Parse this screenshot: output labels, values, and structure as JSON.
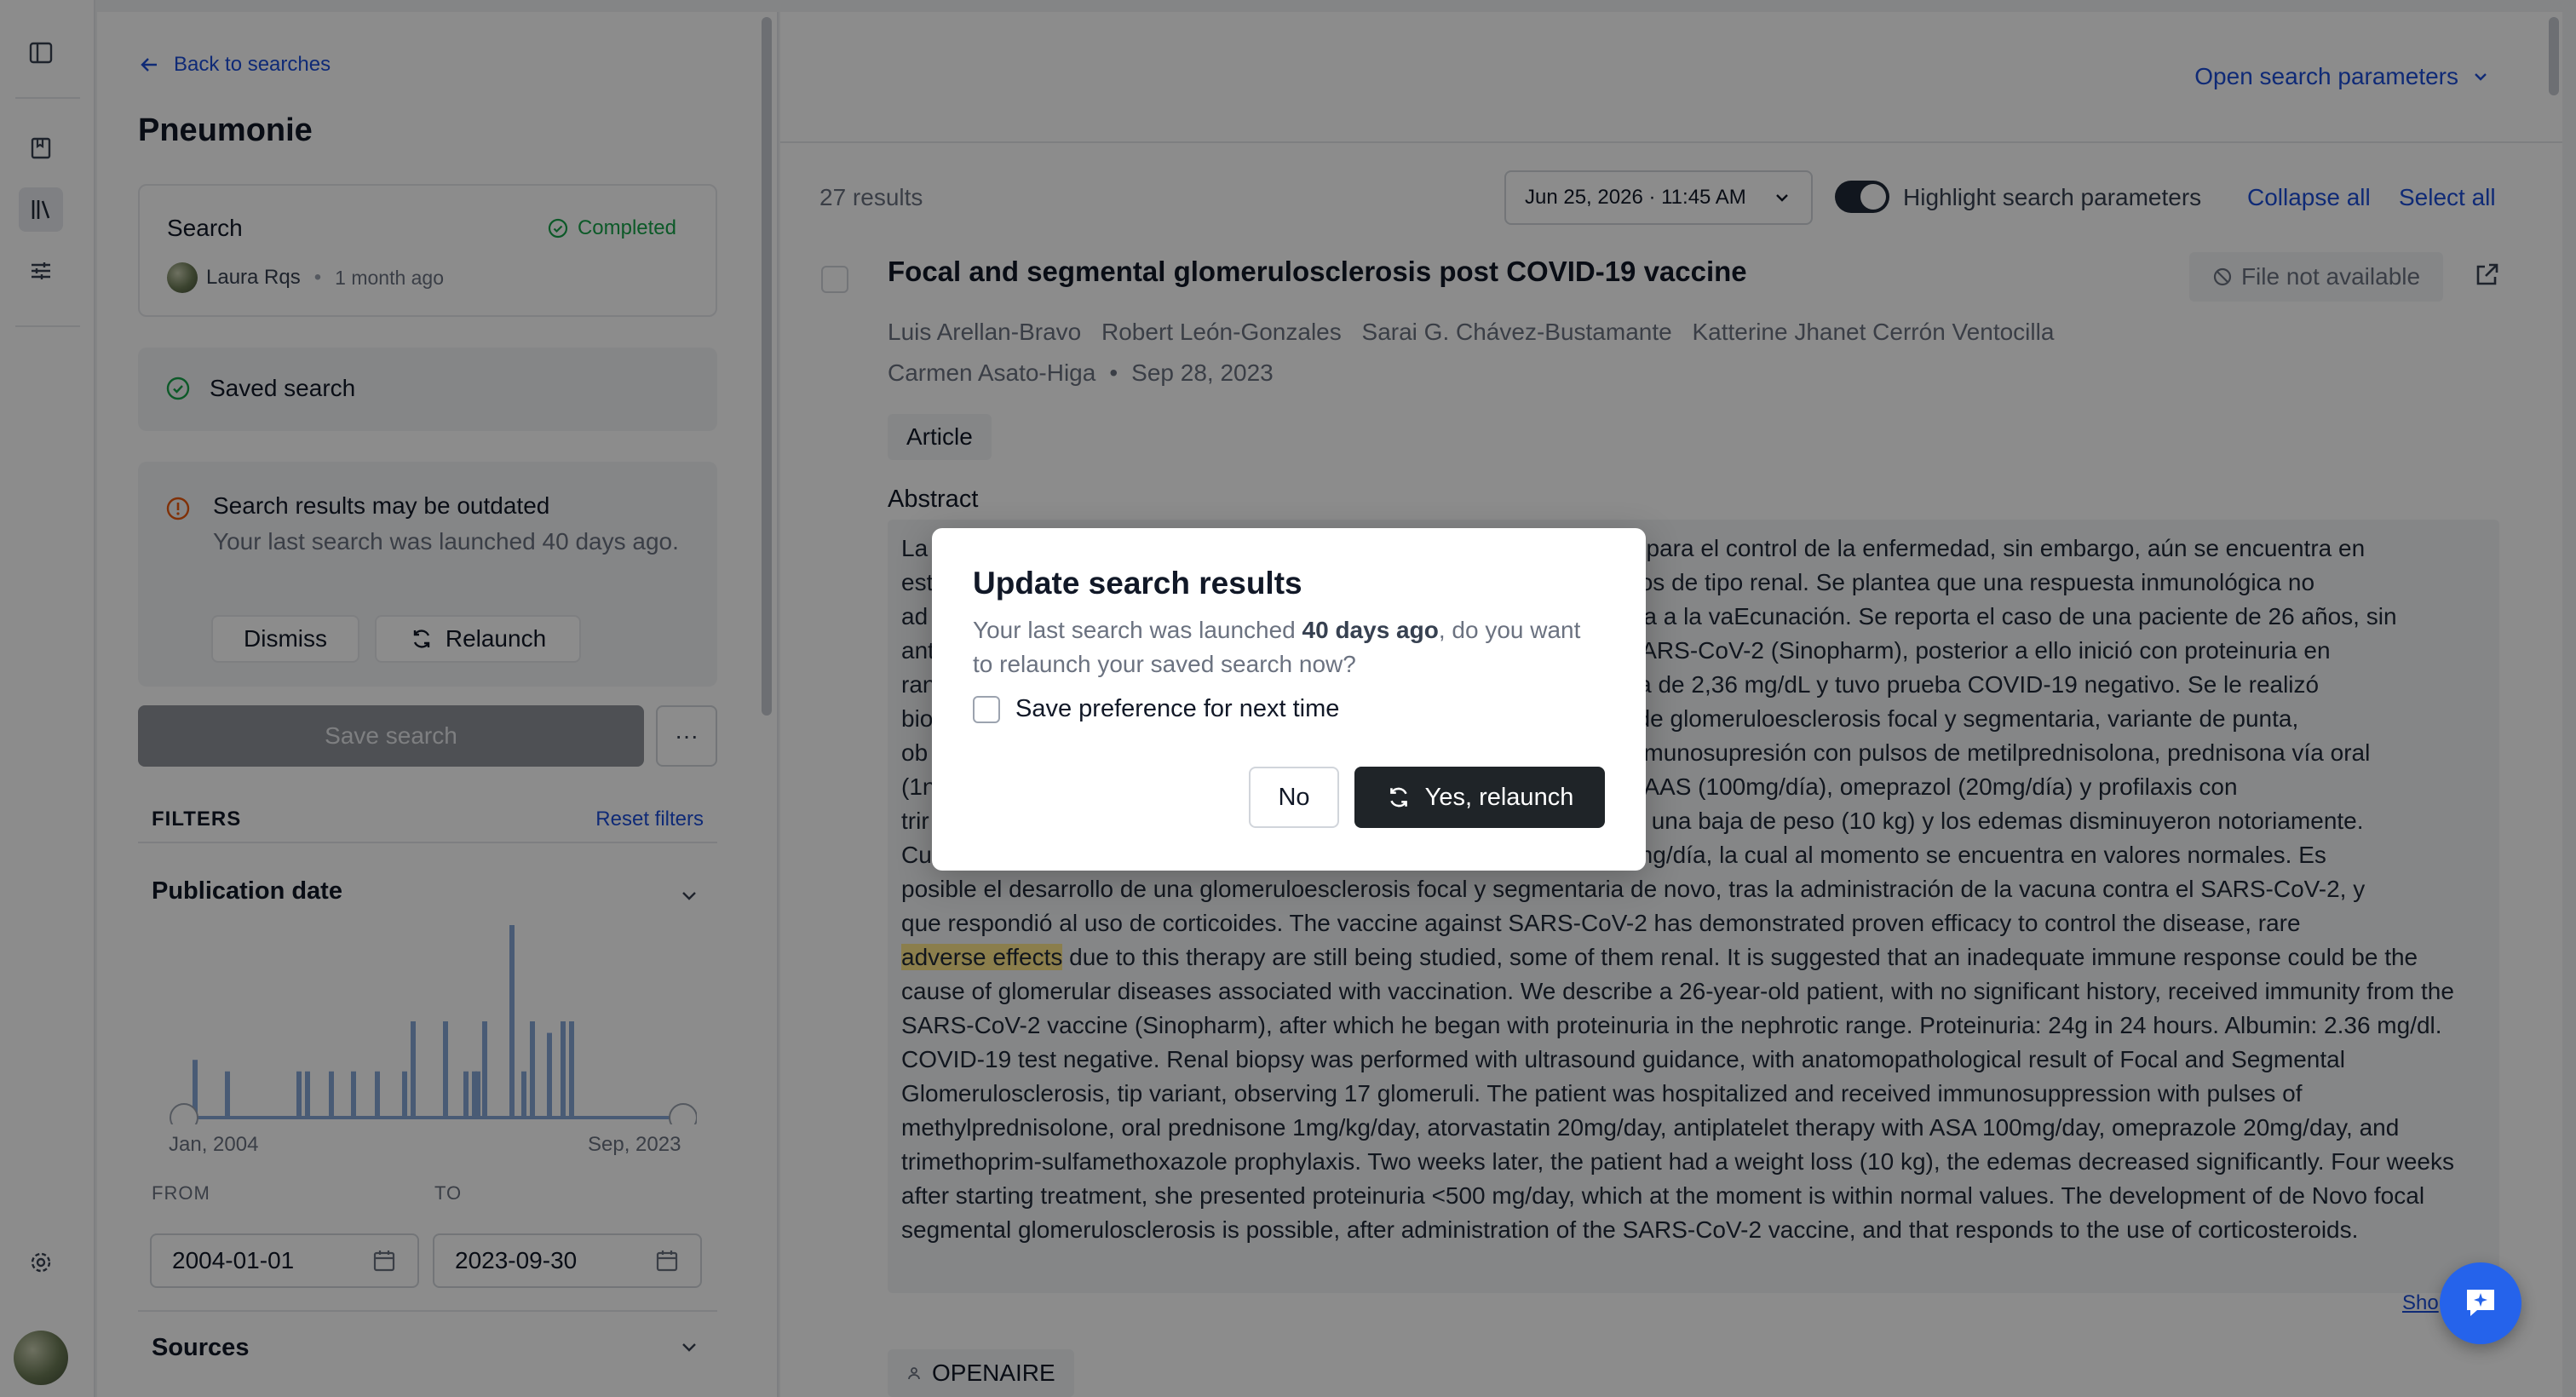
{
  "rail": {
    "icons": [
      "sidebar-toggle-icon",
      "bookmark-icon",
      "library-icon",
      "filters-icon",
      "settings-icon"
    ]
  },
  "sidebar": {
    "back_label": "Back to searches",
    "title": "Pneumonie",
    "search_card": {
      "label": "Search",
      "status": "Completed",
      "author": "Laura Rqs",
      "ago": "1 month ago"
    },
    "saved_label": "Saved search",
    "warning": {
      "title": "Search results may be outdated",
      "text": "Your last search was launched 40 days ago.",
      "dismiss": "Dismiss",
      "relaunch": "Relaunch"
    },
    "save_button": "Save search",
    "more_button": "···",
    "filters_heading": "FILTERS",
    "reset_filters": "Reset filters",
    "publication_date": {
      "heading": "Publication date",
      "range_start_label": "Jan, 2004",
      "range_end_label": "Sep, 2023",
      "from_label": "FROM",
      "to_label": "TO",
      "from_value": "2004-01-01",
      "to_value": "2023-09-30"
    },
    "sources_heading": "Sources"
  },
  "main": {
    "open_params": "Open search parameters",
    "results_count": "27 results",
    "date_select": "Jun 25, 2026 · 11:45 AM",
    "highlight_label": "Highlight search parameters",
    "highlight_on": true,
    "collapse_all": "Collapse all",
    "select_all": "Select all",
    "article": {
      "title": "Focal and segmental glomerulosclerosis post COVID-19 vaccine",
      "file_status": "File not available",
      "authors": [
        "Luis Arellan-Bravo",
        "Robert León-Gonzales",
        "Sarai G. Chávez-Bustamante",
        "Katterine Jhanet Cerrón Ventocilla",
        "Carmen Asato-Higa"
      ],
      "date": "Sep 28, 2023",
      "type_tag": "Article",
      "abstract_heading": "Abstract",
      "abstract_lines": [
        "La",
        "est",
        "ad",
        "ant",
        "ran",
        "bio",
        "ob",
        "(1n",
        "trir",
        "Cu",
        "posible el desarrollo de una glomeruloesclerosis focal y segmentaria de novo, tras la administración de la vacuna contra el SARS-CoV-2, y",
        "que respondió al uso de corticoides. The vaccine against SARS-CoV-2 has demonstrated proven efficacy to control the disease, rare"
      ],
      "abstract_right_fragments": [
        "ada para el control de la enfermedad, sin embargo, aún se encuentra en",
        "gunos de tipo renal. Se plantea que una respuesta inmunológica no",
        "ciada a la vaEcunación. Se reporta el caso de una paciente de 26 años, sin",
        "le SARS-CoV-2 (Sinopharm), posterior a ello inició con proteinuria en",
        "mina de 2,36 mg/dL y tuvo prueba COVID-19 negativo. Se le realizó",
        "ico de glomeruloesclerosis focal y segmentaria, variante de punta,",
        "ió inmunosupresión con pulsos de metilprednisolona, prednisona vía oral",
        "con AAS (100mg/día), omeprazol (20mg/día) y profilaxis con",
        "tuvo una baja de peso (10 kg) y los edemas disminuyeron notoriamente.",
        "00 mg/día, la cual al momento se encuentra en valores normales. Es"
      ],
      "highlight_term": "adverse effects",
      "abstract_rest": " due to this therapy are still being studied, some of them renal. It is suggested that an inadequate immune response could be the cause of glomerular diseases associated with vaccination. We describe a 26-year-old patient, with no significant history, received immunity from the SARS-CoV-2 vaccine (Sinopharm), after which he began with proteinuria in the nephrotic range. Proteinuria: 24g in 24 hours. Albumin: 2.36 mg/dl. COVID-19 test negative. Renal biopsy was performed with ultrasound guidance, with anatomopathological result of Focal and Segmental Glomerulosclerosis, tip variant, observing 17 glomeruli. The patient was hospitalized and received immunosuppression with pulses of methylprednisolone, oral prednisone 1mg/kg/day, atorvastatin 20mg/day, antiplatelet therapy with ASA 100mg/day, omeprazole 20mg/day, and trimethoprim-sulfamethoxazole prophylaxis. Two weeks later, the patient had a weight loss (10 kg), the edemas decreased significantly. Four weeks after starting treatment, she presented proteinuria <500 mg/day, which at the moment is within normal values. The development of de Novo focal segmental glomerulosclerosis is possible, after administration of the SARS-CoV-2 vaccine, and that responds to the use of corticosteroids.",
      "show_more": "Sho",
      "source_tag": "OPENAIRE"
    }
  },
  "modal": {
    "title": "Update search results",
    "desc_prefix": "Your last search was launched ",
    "desc_bold": "40 days ago",
    "desc_suffix": ", do you want to relaunch your saved search now?",
    "pref_label": "Save preference for next time",
    "no_label": "No",
    "yes_label": "Yes, relaunch"
  },
  "histogram": {
    "bars": [
      0.3,
      0.24,
      0.24,
      0.24,
      0.24,
      0.24,
      0.24,
      0.24,
      0.5,
      0.5,
      0.24,
      0.24,
      0.24,
      0.5,
      1.0,
      0.24,
      0.5,
      0.44,
      0.5,
      0.5
    ]
  },
  "colors": {
    "accent": "#1d4ed8",
    "success": "#16a34a",
    "warning": "#ea580c",
    "bar": "#86a6d6",
    "highlight": "#fde68a"
  }
}
